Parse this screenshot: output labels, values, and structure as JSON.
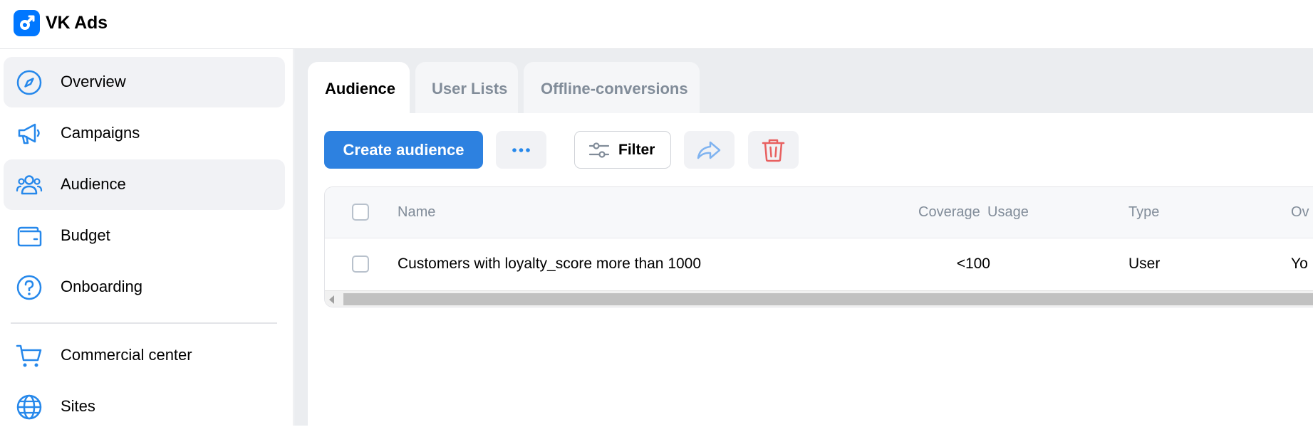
{
  "app": {
    "title": "VK Ads"
  },
  "sidebar": {
    "items": [
      {
        "label": "Overview",
        "icon": "compass-icon"
      },
      {
        "label": "Campaigns",
        "icon": "megaphone-icon"
      },
      {
        "label": "Audience",
        "icon": "users-icon",
        "active": true
      },
      {
        "label": "Budget",
        "icon": "wallet-icon"
      },
      {
        "label": "Onboarding",
        "icon": "help-circle-icon"
      },
      {
        "label": "Commercial center",
        "icon": "cart-icon"
      },
      {
        "label": "Sites",
        "icon": "globe-icon"
      }
    ]
  },
  "tabs": [
    {
      "label": "Audience",
      "active": true
    },
    {
      "label": "User Lists"
    },
    {
      "label": "Offline-conversions"
    }
  ],
  "toolbar": {
    "create_label": "Create audience",
    "more_icon": "more-horizontal-icon",
    "filter_label": "Filter",
    "filter_icon": "sliders-icon",
    "share_icon": "share-icon",
    "delete_icon": "trash-icon"
  },
  "table": {
    "columns": [
      "Name",
      "Coverage",
      "Usage",
      "Type",
      "Ov"
    ],
    "rows": [
      {
        "name": "Customers with loyalty_score more than 1000",
        "coverage": "<100",
        "usage": "",
        "type": "User",
        "owner": "Yo"
      }
    ]
  },
  "colors": {
    "accent": "#2d81e0",
    "brand": "#0077ff",
    "icon_blue": "#2688eb",
    "danger": "#e64646",
    "muted_text": "#818c99",
    "content_bg": "#ebedf0"
  }
}
